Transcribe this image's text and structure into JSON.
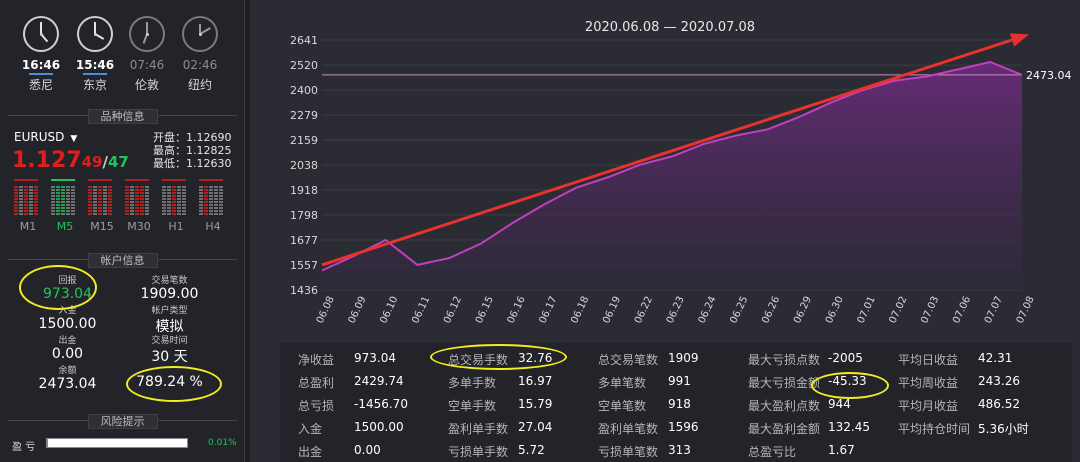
{
  "clocks": [
    {
      "time": "16:46",
      "city": "悉尼",
      "active": true
    },
    {
      "time": "15:46",
      "city": "东京",
      "active": true
    },
    {
      "time": "07:46",
      "city": "伦敦",
      "active": false
    },
    {
      "time": "02:46",
      "city": "纽约",
      "active": false
    }
  ],
  "sections": {
    "symbol_info": "品种信息",
    "account_info": "帐户信息",
    "risk": "风险提示"
  },
  "symbol": {
    "name": "EURUSD",
    "price_main": "1.127",
    "price_red": "49",
    "price_sep": "/",
    "price_green": "47",
    "open": "开盘：1.12690",
    "high": "最高：1.12825",
    "low": "最低：1.12630",
    "timeframes": [
      "M1",
      "M5",
      "M15",
      "M30",
      "H1",
      "H4"
    ],
    "active_timeframe": "M5"
  },
  "account": {
    "return_label": "回报",
    "return_value": "973.04",
    "trades_label": "交易笔数",
    "trades_value": "1909.00",
    "deposit_label": "入金",
    "deposit_value": "1500.00",
    "type_label": "帐户类型",
    "type_value": "模拟",
    "withdraw_label": "出金",
    "withdraw_value": "0.00",
    "time_label": "交易时间",
    "time_value": "30 天",
    "balance_label": "余额",
    "balance_value": "2473.04",
    "gain_value": "789.24 %"
  },
  "risk": {
    "label": "盈 亏",
    "value": "0.01%",
    "fill_fraction": 0.0001
  },
  "chart_data": {
    "type": "area",
    "title": "2020.06.08 — 2020.07.08",
    "categories": [
      "06.08",
      "06.09",
      "06.10",
      "06.11",
      "06.12",
      "06.15",
      "06.16",
      "06.17",
      "06.18",
      "06.19",
      "06.22",
      "06.23",
      "06.24",
      "06.25",
      "06.26",
      "06.29",
      "06.30",
      "07.01",
      "07.02",
      "07.03",
      "07.06",
      "07.07",
      "07.08"
    ],
    "values": [
      1530,
      1600,
      1677,
      1557,
      1590,
      1660,
      1760,
      1850,
      1930,
      1980,
      2040,
      2080,
      2140,
      2180,
      2210,
      2270,
      2340,
      2400,
      2445,
      2465,
      2500,
      2535,
      2473.04
    ],
    "yticks": [
      1436,
      1557,
      1677,
      1798,
      1918,
      2038,
      2159,
      2279,
      2400,
      2520,
      2641
    ],
    "ylim": [
      1436,
      2641
    ],
    "last_value_label": "2473.04",
    "reference_line": 2473.04,
    "trend_arrow": {
      "from": [
        "06.08",
        1557
      ],
      "to": [
        "07.08",
        2641
      ]
    },
    "colors": {
      "line": "#c040c0",
      "fill_top": "#6a2b7a",
      "arrow": "#e8322d",
      "grid": "#3c3d45"
    }
  },
  "stats": [
    [
      {
        "k": "净收益",
        "v": "973.04"
      },
      {
        "k": "总盈利",
        "v": "2429.74"
      },
      {
        "k": "总亏损",
        "v": "-1456.70"
      },
      {
        "k": "入金",
        "v": "1500.00"
      },
      {
        "k": "出金",
        "v": "0.00"
      }
    ],
    [
      {
        "k": "总交易手数",
        "v": "32.76"
      },
      {
        "k": "多单手数",
        "v": "16.97"
      },
      {
        "k": "空单手数",
        "v": "15.79"
      },
      {
        "k": "盈利单手数",
        "v": "27.04"
      },
      {
        "k": "亏损单手数",
        "v": "5.72"
      }
    ],
    [
      {
        "k": "总交易笔数",
        "v": "1909"
      },
      {
        "k": "多单笔数",
        "v": "991"
      },
      {
        "k": "空单笔数",
        "v": "918"
      },
      {
        "k": "盈利单笔数",
        "v": "1596"
      },
      {
        "k": "亏损单笔数",
        "v": "313"
      }
    ],
    [
      {
        "k": "最大亏损点数",
        "v": "-2005"
      },
      {
        "k": "最大亏损金额",
        "v": "-45.33"
      },
      {
        "k": "最大盈利点数",
        "v": "944"
      },
      {
        "k": "最大盈利金额",
        "v": "132.45"
      },
      {
        "k": "总盈亏比",
        "v": "1.67"
      }
    ],
    [
      {
        "k": "平均日收益",
        "v": "42.31"
      },
      {
        "k": "平均周收益",
        "v": "243.26"
      },
      {
        "k": "平均月收益",
        "v": "486.52"
      },
      {
        "k": "平均持仓时间",
        "v": "5.36小时"
      }
    ]
  ]
}
